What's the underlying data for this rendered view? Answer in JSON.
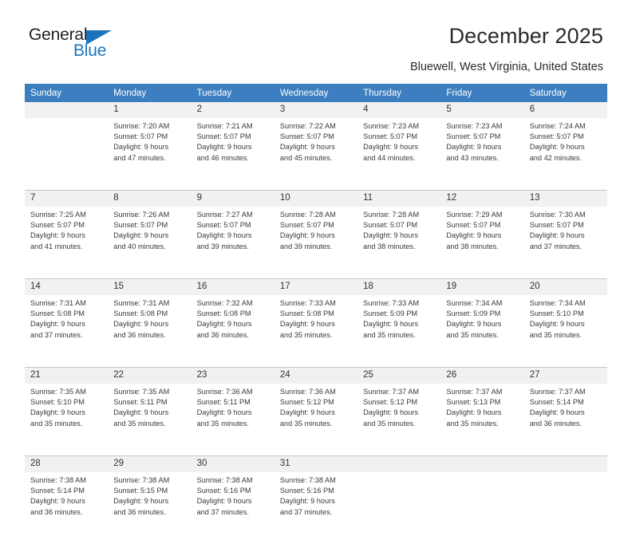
{
  "brand": {
    "name_part1": "General",
    "name_part2": "Blue",
    "triangle_icon": "triangle-icon",
    "color_dark": "#231f20",
    "color_blue": "#1a74bb"
  },
  "header": {
    "title": "December 2025",
    "subtitle": "Bluewell, West Virginia, United States",
    "header_bg": "#3c7ebf",
    "daynum_bg": "#f1f1f1"
  },
  "weekday_headers": [
    "Sunday",
    "Monday",
    "Tuesday",
    "Wednesday",
    "Thursday",
    "Friday",
    "Saturday"
  ],
  "weeks": [
    {
      "days": [
        {
          "num": "",
          "lines": []
        },
        {
          "num": "1",
          "lines": [
            "Sunrise: 7:20 AM",
            "Sunset: 5:07 PM",
            "Daylight: 9 hours",
            "and 47 minutes."
          ]
        },
        {
          "num": "2",
          "lines": [
            "Sunrise: 7:21 AM",
            "Sunset: 5:07 PM",
            "Daylight: 9 hours",
            "and 46 minutes."
          ]
        },
        {
          "num": "3",
          "lines": [
            "Sunrise: 7:22 AM",
            "Sunset: 5:07 PM",
            "Daylight: 9 hours",
            "and 45 minutes."
          ]
        },
        {
          "num": "4",
          "lines": [
            "Sunrise: 7:23 AM",
            "Sunset: 5:07 PM",
            "Daylight: 9 hours",
            "and 44 minutes."
          ]
        },
        {
          "num": "5",
          "lines": [
            "Sunrise: 7:23 AM",
            "Sunset: 5:07 PM",
            "Daylight: 9 hours",
            "and 43 minutes."
          ]
        },
        {
          "num": "6",
          "lines": [
            "Sunrise: 7:24 AM",
            "Sunset: 5:07 PM",
            "Daylight: 9 hours",
            "and 42 minutes."
          ]
        }
      ]
    },
    {
      "days": [
        {
          "num": "7",
          "lines": [
            "Sunrise: 7:25 AM",
            "Sunset: 5:07 PM",
            "Daylight: 9 hours",
            "and 41 minutes."
          ]
        },
        {
          "num": "8",
          "lines": [
            "Sunrise: 7:26 AM",
            "Sunset: 5:07 PM",
            "Daylight: 9 hours",
            "and 40 minutes."
          ]
        },
        {
          "num": "9",
          "lines": [
            "Sunrise: 7:27 AM",
            "Sunset: 5:07 PM",
            "Daylight: 9 hours",
            "and 39 minutes."
          ]
        },
        {
          "num": "10",
          "lines": [
            "Sunrise: 7:28 AM",
            "Sunset: 5:07 PM",
            "Daylight: 9 hours",
            "and 39 minutes."
          ]
        },
        {
          "num": "11",
          "lines": [
            "Sunrise: 7:28 AM",
            "Sunset: 5:07 PM",
            "Daylight: 9 hours",
            "and 38 minutes."
          ]
        },
        {
          "num": "12",
          "lines": [
            "Sunrise: 7:29 AM",
            "Sunset: 5:07 PM",
            "Daylight: 9 hours",
            "and 38 minutes."
          ]
        },
        {
          "num": "13",
          "lines": [
            "Sunrise: 7:30 AM",
            "Sunset: 5:07 PM",
            "Daylight: 9 hours",
            "and 37 minutes."
          ]
        }
      ]
    },
    {
      "days": [
        {
          "num": "14",
          "lines": [
            "Sunrise: 7:31 AM",
            "Sunset: 5:08 PM",
            "Daylight: 9 hours",
            "and 37 minutes."
          ]
        },
        {
          "num": "15",
          "lines": [
            "Sunrise: 7:31 AM",
            "Sunset: 5:08 PM",
            "Daylight: 9 hours",
            "and 36 minutes."
          ]
        },
        {
          "num": "16",
          "lines": [
            "Sunrise: 7:32 AM",
            "Sunset: 5:08 PM",
            "Daylight: 9 hours",
            "and 36 minutes."
          ]
        },
        {
          "num": "17",
          "lines": [
            "Sunrise: 7:33 AM",
            "Sunset: 5:08 PM",
            "Daylight: 9 hours",
            "and 35 minutes."
          ]
        },
        {
          "num": "18",
          "lines": [
            "Sunrise: 7:33 AM",
            "Sunset: 5:09 PM",
            "Daylight: 9 hours",
            "and 35 minutes."
          ]
        },
        {
          "num": "19",
          "lines": [
            "Sunrise: 7:34 AM",
            "Sunset: 5:09 PM",
            "Daylight: 9 hours",
            "and 35 minutes."
          ]
        },
        {
          "num": "20",
          "lines": [
            "Sunrise: 7:34 AM",
            "Sunset: 5:10 PM",
            "Daylight: 9 hours",
            "and 35 minutes."
          ]
        }
      ]
    },
    {
      "days": [
        {
          "num": "21",
          "lines": [
            "Sunrise: 7:35 AM",
            "Sunset: 5:10 PM",
            "Daylight: 9 hours",
            "and 35 minutes."
          ]
        },
        {
          "num": "22",
          "lines": [
            "Sunrise: 7:35 AM",
            "Sunset: 5:11 PM",
            "Daylight: 9 hours",
            "and 35 minutes."
          ]
        },
        {
          "num": "23",
          "lines": [
            "Sunrise: 7:36 AM",
            "Sunset: 5:11 PM",
            "Daylight: 9 hours",
            "and 35 minutes."
          ]
        },
        {
          "num": "24",
          "lines": [
            "Sunrise: 7:36 AM",
            "Sunset: 5:12 PM",
            "Daylight: 9 hours",
            "and 35 minutes."
          ]
        },
        {
          "num": "25",
          "lines": [
            "Sunrise: 7:37 AM",
            "Sunset: 5:12 PM",
            "Daylight: 9 hours",
            "and 35 minutes."
          ]
        },
        {
          "num": "26",
          "lines": [
            "Sunrise: 7:37 AM",
            "Sunset: 5:13 PM",
            "Daylight: 9 hours",
            "and 35 minutes."
          ]
        },
        {
          "num": "27",
          "lines": [
            "Sunrise: 7:37 AM",
            "Sunset: 5:14 PM",
            "Daylight: 9 hours",
            "and 36 minutes."
          ]
        }
      ]
    },
    {
      "days": [
        {
          "num": "28",
          "lines": [
            "Sunrise: 7:38 AM",
            "Sunset: 5:14 PM",
            "Daylight: 9 hours",
            "and 36 minutes."
          ]
        },
        {
          "num": "29",
          "lines": [
            "Sunrise: 7:38 AM",
            "Sunset: 5:15 PM",
            "Daylight: 9 hours",
            "and 36 minutes."
          ]
        },
        {
          "num": "30",
          "lines": [
            "Sunrise: 7:38 AM",
            "Sunset: 5:16 PM",
            "Daylight: 9 hours",
            "and 37 minutes."
          ]
        },
        {
          "num": "31",
          "lines": [
            "Sunrise: 7:38 AM",
            "Sunset: 5:16 PM",
            "Daylight: 9 hours",
            "and 37 minutes."
          ]
        },
        {
          "num": "",
          "lines": []
        },
        {
          "num": "",
          "lines": []
        },
        {
          "num": "",
          "lines": []
        }
      ]
    }
  ]
}
